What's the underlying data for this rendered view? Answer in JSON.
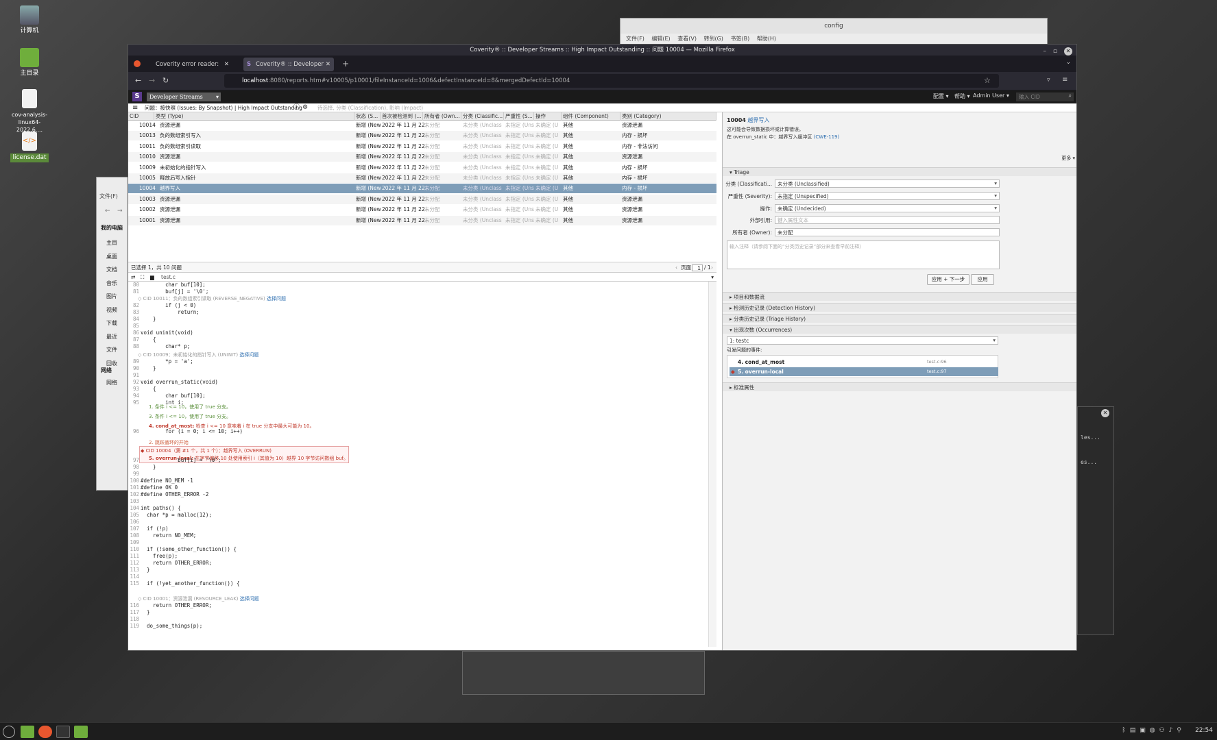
{
  "desktop": {
    "icons": [
      {
        "label": "计算机",
        "name": "computer-desktop-icon"
      },
      {
        "label": "主目录",
        "name": "home-folder-desktop-icon"
      },
      {
        "label": "cov-analysis-linux64-2022.6....",
        "name": "cov-analysis-file-icon"
      },
      {
        "label": "license.dat",
        "name": "license-file-icon"
      }
    ]
  },
  "bg_windows": {
    "config_title": "config",
    "config_menu": "文件(F) 编辑(E) 查看(V) 转到(G) 书签(B) 帮助(H)",
    "fm_menu": "文件(F)",
    "fm_sidebar_header": "我的电脑",
    "fm_sidebar": [
      "主目",
      "桌面",
      "文档",
      "音乐",
      "图片",
      "视频",
      "下载",
      "最近",
      "文件",
      "回收"
    ],
    "fm_network": "网络",
    "fm_network_item": "网络",
    "term_lines": [
      "les...",
      "es..."
    ]
  },
  "firefox": {
    "window_title": "Coverity® :: Developer Streams :: High Impact Outstanding :: 问题 10004 — Mozilla Firefox",
    "tabs": [
      {
        "label": "Coverity error reader: /home/u"
      },
      {
        "label": "Coverity® :: Developer Stre"
      }
    ],
    "url_host": "localhost",
    "url_rest": ":8080/reports.htm#v10005/p10001/fileInstanceId=1006&defectInstanceId=8&mergedDefectId=10004"
  },
  "app": {
    "stream": "Developer Streams",
    "menus": [
      "配置 ▾",
      "帮助 ▾",
      "Admin User ▾"
    ],
    "cid_placeholder": "输入 CID",
    "view_label": "问题：按快照 (Issues: By Snapshot) | High Impact Outstanding",
    "filter_hint": "待选择, 分类 (Classification), 影响 (Impact)",
    "columns": [
      "CID",
      "类型 (Type)",
      "状态 (S...",
      "首次被检测到 (...",
      "所有者 (Own...",
      "分类 (Classific...",
      "严重性 (S...",
      "操作",
      "组件 (Component)",
      "类别 (Category)"
    ],
    "rows": [
      {
        "cid": "10014",
        "type": "资源泄漏",
        "status": "新增 (New",
        "date": "2022 年 11 月 22",
        "owner": "未分配",
        "cls": "未分类 (Unclass",
        "sev": "未指定 (Uns",
        "act": "未确定 (U",
        "comp": "其他",
        "cat": "资源泄漏"
      },
      {
        "cid": "10013",
        "type": "负的数组索引写入",
        "status": "新增 (New",
        "date": "2022 年 11 月 22",
        "owner": "未分配",
        "cls": "未分类 (Unclass",
        "sev": "未指定 (Uns",
        "act": "未确定 (U",
        "comp": "其他",
        "cat": "内存 - 损坏"
      },
      {
        "cid": "10011",
        "type": "负的数组索引读取",
        "status": "新增 (New",
        "date": "2022 年 11 月 22",
        "owner": "未分配",
        "cls": "未分类 (Unclass",
        "sev": "未指定 (Uns",
        "act": "未确定 (U",
        "comp": "其他",
        "cat": "内存 - 非法访问"
      },
      {
        "cid": "10010",
        "type": "资源泄漏",
        "status": "新增 (New",
        "date": "2022 年 11 月 22",
        "owner": "未分配",
        "cls": "未分类 (Unclass",
        "sev": "未指定 (Uns",
        "act": "未确定 (U",
        "comp": "其他",
        "cat": "资源泄漏"
      },
      {
        "cid": "10009",
        "type": "未初始化的指针写入",
        "status": "新增 (New",
        "date": "2022 年 11 月 22",
        "owner": "未分配",
        "cls": "未分类 (Unclass",
        "sev": "未指定 (Uns",
        "act": "未确定 (U",
        "comp": "其他",
        "cat": "内存 - 损坏"
      },
      {
        "cid": "10005",
        "type": "释放后写入指针",
        "status": "新增 (New",
        "date": "2022 年 11 月 22",
        "owner": "未分配",
        "cls": "未分类 (Unclass",
        "sev": "未指定 (Uns",
        "act": "未确定 (U",
        "comp": "其他",
        "cat": "内存 - 损坏"
      },
      {
        "cid": "10004",
        "type": "越界写入",
        "status": "新增 (New",
        "date": "2022 年 11 月 22",
        "owner": "未分配",
        "cls": "未分类 (Unclass",
        "sev": "未指定 (Uns",
        "act": "未确定 (U",
        "comp": "其他",
        "cat": "内存 - 损坏"
      },
      {
        "cid": "10003",
        "type": "资源泄漏",
        "status": "新增 (New",
        "date": "2022 年 11 月 22",
        "owner": "未分配",
        "cls": "未分类 (Unclass",
        "sev": "未指定 (Uns",
        "act": "未确定 (U",
        "comp": "其他",
        "cat": "资源泄漏"
      },
      {
        "cid": "10002",
        "type": "资源泄漏",
        "status": "新增 (New",
        "date": "2022 年 11 月 22",
        "owner": "未分配",
        "cls": "未分类 (Unclass",
        "sev": "未指定 (Uns",
        "act": "未确定 (U",
        "comp": "其他",
        "cat": "资源泄漏"
      },
      {
        "cid": "10001",
        "type": "资源泄漏",
        "status": "新增 (New",
        "date": "2022 年 11 月 22",
        "owner": "未分配",
        "cls": "未分类 (Unclass",
        "sev": "未指定 (Uns",
        "act": "未确定 (U",
        "comp": "其他",
        "cat": "资源泄漏"
      }
    ],
    "selected_cid": "10004",
    "selection_text": "已选择 1，共 10 问题",
    "pager_label": "页面",
    "pager_value": "1",
    "pager_total": "/ 1",
    "file_tab": "test.c",
    "code": [
      {
        "ln": "80",
        "text": "        char buf[10];"
      },
      {
        "ln": "81",
        "text": "        buf[j] = '\\0';"
      },
      {
        "ln": "82",
        "text": "        if (j < 0)"
      },
      {
        "ln": "83",
        "text": "            return;"
      },
      {
        "ln": "84",
        "text": "    }"
      },
      {
        "ln": "85",
        "text": ""
      },
      {
        "ln": "86",
        "text": "void uninit(void)"
      },
      {
        "ln": "87",
        "text": "    {"
      },
      {
        "ln": "88",
        "text": "        char* p;"
      },
      {
        "ln": "89",
        "text": "        *p = 'a';"
      },
      {
        "ln": "90",
        "text": "    }"
      },
      {
        "ln": "91",
        "text": ""
      },
      {
        "ln": "92",
        "text": "void overrun_static(void)"
      },
      {
        "ln": "93",
        "text": "    {"
      },
      {
        "ln": "94",
        "text": "        char buf[10];"
      },
      {
        "ln": "95",
        "text": "        int i;"
      },
      {
        "ln": "96",
        "text": "        for (i = 0; i <= 10; i++)"
      },
      {
        "ln": "97",
        "text": "            buf[i] = '\\0';"
      },
      {
        "ln": "98",
        "text": "    }"
      },
      {
        "ln": "99",
        "text": ""
      },
      {
        "ln": "100",
        "text": "#define NO_MEM -1"
      },
      {
        "ln": "101",
        "text": "#define OK 0"
      },
      {
        "ln": "102",
        "text": "#define OTHER_ERROR -2"
      },
      {
        "ln": "103",
        "text": ""
      },
      {
        "ln": "104",
        "text": "int paths() {"
      },
      {
        "ln": "105",
        "text": "  char *p = malloc(12);"
      },
      {
        "ln": "106",
        "text": ""
      },
      {
        "ln": "107",
        "text": "  if (!p)"
      },
      {
        "ln": "108",
        "text": "    return NO_MEM;"
      },
      {
        "ln": "109",
        "text": ""
      },
      {
        "ln": "110",
        "text": "  if (!some_other_function()) {"
      },
      {
        "ln": "111",
        "text": "    free(p);"
      },
      {
        "ln": "112",
        "text": "    return OTHER_ERROR;"
      },
      {
        "ln": "113",
        "text": "  }"
      },
      {
        "ln": "114",
        "text": ""
      },
      {
        "ln": "115",
        "text": "  if (!yet_another_function()) {"
      },
      {
        "ln": "116",
        "text": "    return OTHER_ERROR;"
      },
      {
        "ln": "117",
        "text": "  }"
      },
      {
        "ln": "118",
        "text": ""
      },
      {
        "ln": "119",
        "text": "  do_some_things(p);"
      }
    ],
    "events": {
      "cid10011": "CID 10011：负的数组索引读取 (REVERSE_NEGATIVE)",
      "cid10009": "CID 10009：未初始化的指针写入 (UNINIT)",
      "cid10001": "CID 10001：资源泄漏 (RESOURCE_LEAK)",
      "select_issue": "选择问题",
      "ev1": "1. 条件 i <= 10，使用了 true 分支。",
      "ev3": "3. 条件 i <= 10，使用了 true 分支。",
      "ev4_bold": "4. cond_at_most:",
      "ev4_text": "检查 i <= 10 意味着 i 在 true 分支中最大可能为 10。",
      "ev2": "2. 跳跃循环的开始",
      "main_head": "CID 10004（第 #1 个，共 1 个）：越界写入 (OVERRUN)",
      "ev5_bold": "5. overrun-local:",
      "ev5_text": "在字节偏移 10 处使用索引 i（其值为 10）越界 10 字节访问数组 buf。"
    },
    "detail": {
      "cid": "10004",
      "title_link": "越界写入",
      "desc1": "这可能会导致数据损坏或计算错误。",
      "desc2_prefix": "在 overrun_static 中：越界写入缓冲区",
      "cwe": "(CWE-119)",
      "more": "更多 ▾",
      "triage_head": "Triage",
      "labels": {
        "cls": "分类 (Classificati...",
        "sev": "严重性 (Severity):",
        "act": "操作:",
        "ext": "外部引用:",
        "owner": "所有者 (Owner):"
      },
      "cls_value": "未分类 (Unclassified)",
      "sev_value": "未指定 (Unspecified)",
      "act_value": "未确定 (Undecided)",
      "ext_placeholder": "键入属性文本",
      "owner_value": "未分配",
      "comment_placeholder": "输入注释（请参阅下面的“分类历史记录”部分来查看早前注释）",
      "btn_apply_next": "应用 + 下一步",
      "btn_apply": "应用",
      "sections": [
        "项目和数据流",
        "检测历史记录 (Detection History)",
        "分类历史记录 (Triage History)",
        "出现次数 (Occurrences)"
      ],
      "occ_select": "1: testc",
      "occ_events_label": "引发问题的事件:",
      "occ_rows": [
        {
          "label": "4. cond_at_most",
          "loc": "test.c:96"
        },
        {
          "label": "5. overrun-local",
          "loc": "test.c:97"
        }
      ],
      "std_attr": "标准属性"
    }
  },
  "taskbar": {
    "clock": "22:54"
  },
  "colors": {
    "accent_selected_row": "#7e9db8",
    "coverity_purple": "#5b3a8e",
    "desktop_bg": "#2b2b2b"
  }
}
